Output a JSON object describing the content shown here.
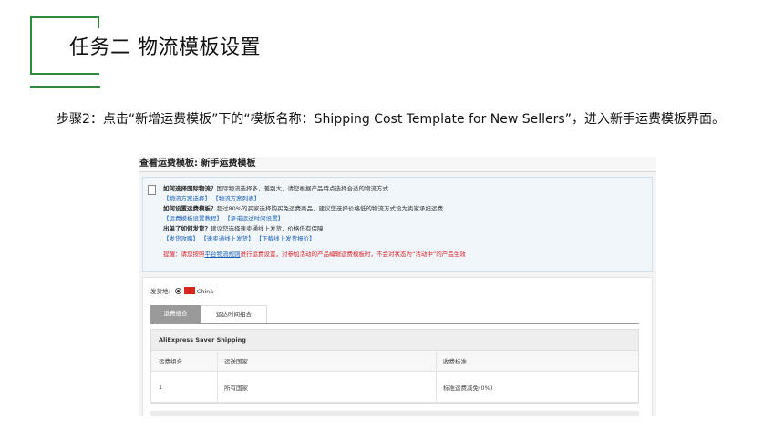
{
  "slide": {
    "title": "任务二 物流模板设置",
    "step_text": "步骤2：点击“新增运费模板”下的“模板名称：Shipping Cost Template for New Sellers”，进入新手运费模板界面。"
  },
  "screenshot": {
    "header_title": "查看运费模板: 新手运费模板",
    "notice": {
      "q1": "如何选择国际物流？",
      "q1_text": "国际物流选择多，差别大，请您根据产品特点选择合适的物流方式",
      "q1_links": [
        "【物流方案选择】",
        "【物流方案列表】"
      ],
      "q2": "如何设置运费模板？",
      "q2_text": "超过80%的买家选择购买免运费商品，建议您选择价格低的物流方式设为卖家承担运费",
      "q2_links": [
        "【运费模板设置教程】",
        "【承诺运达时间设置】"
      ],
      "q3": "出单了如何发货？",
      "q3_text": "建议您选择速卖通线上发货，价格低有保障",
      "q3_links": [
        "【发货攻略】",
        "【速卖通线上发货】",
        "【下载线上发货报价】"
      ],
      "warn_prefix": "提醒：请您按照",
      "warn_link": "平台物流规则",
      "warn_suffix": "进行运费设置，对参加活动的产品编辑运费模板时，不会对状态为“活动中”的产品生效"
    },
    "origin_label": "发货地:",
    "origin_value": "China",
    "tabs": [
      "运费组合",
      "运达时间组合"
    ],
    "table": {
      "title": "AliExpress Saver Shipping",
      "headers": [
        "运费组合",
        "运送国家",
        "收费标准"
      ],
      "rows": [
        [
          "1",
          "所有国家",
          "标准运费减免(0%)"
        ]
      ]
    },
    "colors": {
      "accent_green": "#2e8b3e",
      "link_blue": "#1a5fb4",
      "warn_red": "#d9252a"
    }
  }
}
